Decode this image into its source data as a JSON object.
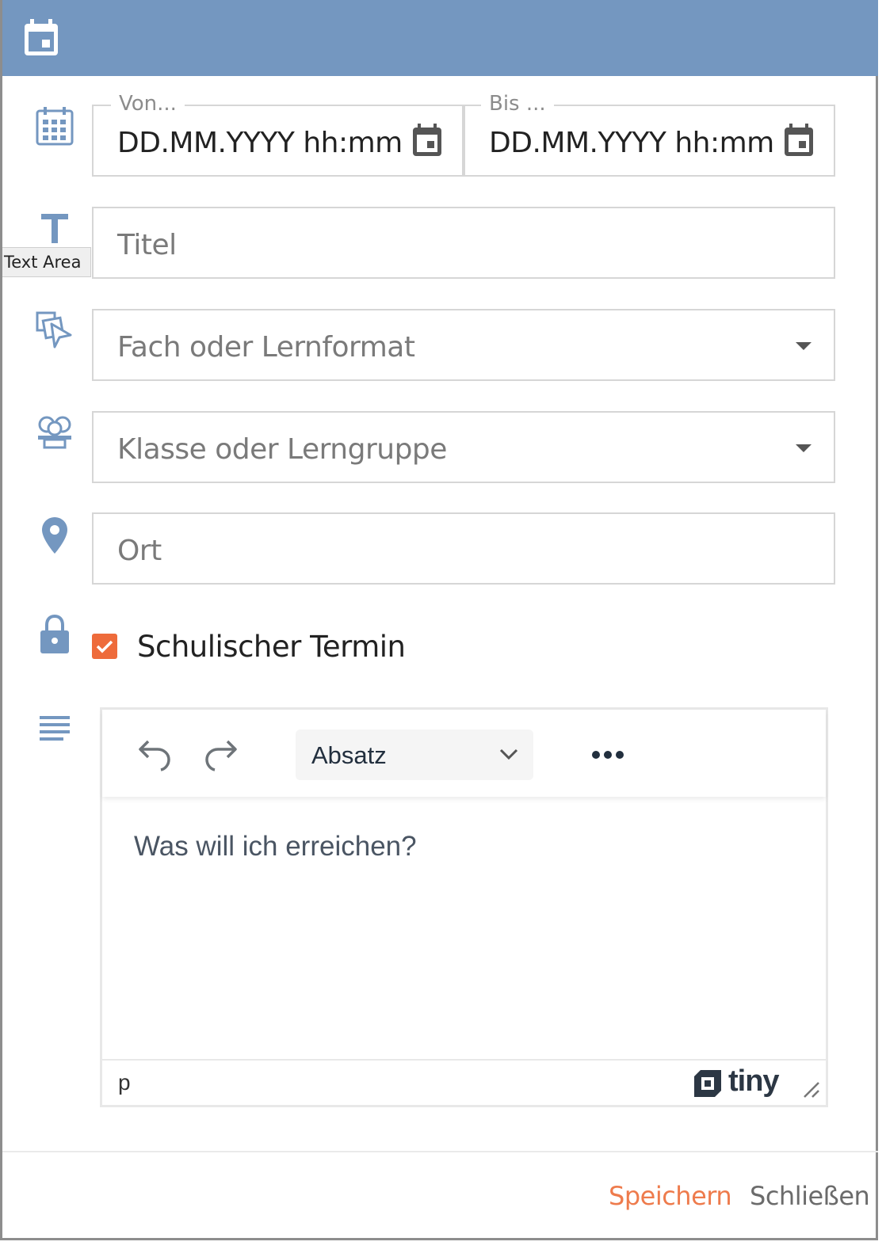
{
  "header": {
    "icon": "calendar-icon",
    "color": "#7497c0"
  },
  "date_range": {
    "from": {
      "legend": "Von...",
      "value": "DD.MM.YYYY hh:mm"
    },
    "to": {
      "legend": "Bis ...",
      "value": "DD.MM.YYYY hh:mm"
    }
  },
  "title": {
    "placeholder": "Titel",
    "tooltip": "Text Area"
  },
  "subject": {
    "placeholder": "Fach oder Lernformat"
  },
  "group": {
    "placeholder": "Klasse oder Lerngruppe"
  },
  "location": {
    "placeholder": "Ort"
  },
  "school_event": {
    "label": "Schulischer Termin",
    "checked": true,
    "color": "#ee6b3b"
  },
  "editor": {
    "format_label": "Absatz",
    "content": "Was will ich erreichen?",
    "path": "p",
    "brand": "tiny"
  },
  "footer": {
    "save_label": "Speichern",
    "close_label": "Schließen",
    "accent": "#ee7b4c"
  }
}
